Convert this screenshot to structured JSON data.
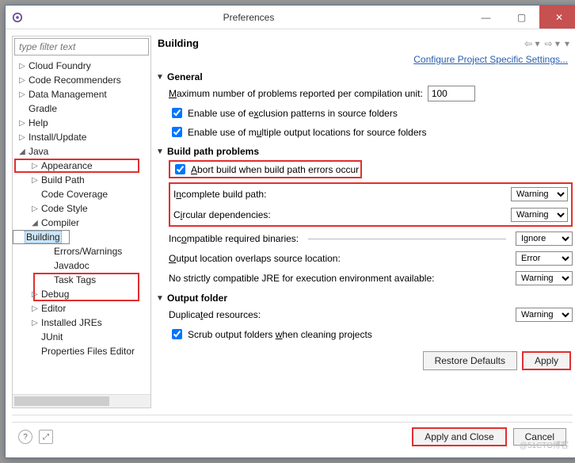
{
  "window": {
    "title": "Preferences"
  },
  "sidebar": {
    "filter_placeholder": "type filter text",
    "items": [
      {
        "label": "Cloud Foundry",
        "level": 0,
        "tw": "▷"
      },
      {
        "label": "Code Recommenders",
        "level": 0,
        "tw": "▷"
      },
      {
        "label": "Data Management",
        "level": 0,
        "tw": "▷"
      },
      {
        "label": "Gradle",
        "level": 0,
        "tw": ""
      },
      {
        "label": "Help",
        "level": 0,
        "tw": "▷"
      },
      {
        "label": "Install/Update",
        "level": 0,
        "tw": "▷"
      },
      {
        "label": "Java",
        "level": 0,
        "tw": "◢"
      },
      {
        "label": "Appearance",
        "level": 1,
        "tw": "▷"
      },
      {
        "label": "Build Path",
        "level": 1,
        "tw": "▷"
      },
      {
        "label": "Code Coverage",
        "level": 1,
        "tw": ""
      },
      {
        "label": "Code Style",
        "level": 1,
        "tw": "▷"
      },
      {
        "label": "Compiler",
        "level": 1,
        "tw": "◢"
      },
      {
        "label": "Building",
        "level": 2,
        "tw": "",
        "sel": true
      },
      {
        "label": "Errors/Warnings",
        "level": 2,
        "tw": ""
      },
      {
        "label": "Javadoc",
        "level": 2,
        "tw": ""
      },
      {
        "label": "Task Tags",
        "level": 2,
        "tw": ""
      },
      {
        "label": "Debug",
        "level": 1,
        "tw": "▷"
      },
      {
        "label": "Editor",
        "level": 1,
        "tw": "▷"
      },
      {
        "label": "Installed JREs",
        "level": 1,
        "tw": "▷"
      },
      {
        "label": "JUnit",
        "level": 1,
        "tw": ""
      },
      {
        "label": "Properties Files Editor",
        "level": 1,
        "tw": ""
      }
    ]
  },
  "content": {
    "title": "Building",
    "link": "Configure Project Specific Settings...",
    "sections": {
      "general": {
        "title": "General",
        "max_label": "Maximum number of problems reported per compilation unit:",
        "max_value": "100",
        "enable_exclusion": "Enable use of exclusion patterns in source folders",
        "enable_multiple": "Enable use of multiple output locations for source folders"
      },
      "build_path": {
        "title": "Build path problems",
        "abort": "Abort build when build path errors occur",
        "incomplete_label": "Incomplete build path:",
        "incomplete_value": "Warning",
        "circular_label": "Circular dependencies:",
        "circular_value": "Warning",
        "incompat_label": "Incompatible required binaries:",
        "incompat_value": "Ignore",
        "output_overlap_label": "Output location overlaps source location:",
        "output_overlap_value": "Error",
        "no_jre_label": "No strictly compatible JRE for execution environment available:",
        "no_jre_value": "Warning"
      },
      "output": {
        "title": "Output folder",
        "dup_label": "Duplicated resources:",
        "dup_value": "Warning",
        "scrub": "Scrub output folders when cleaning projects"
      }
    },
    "buttons": {
      "restore": "Restore Defaults",
      "apply": "Apply",
      "apply_close": "Apply and Close",
      "cancel": "Cancel"
    }
  },
  "watermark": "@51CTO博客"
}
